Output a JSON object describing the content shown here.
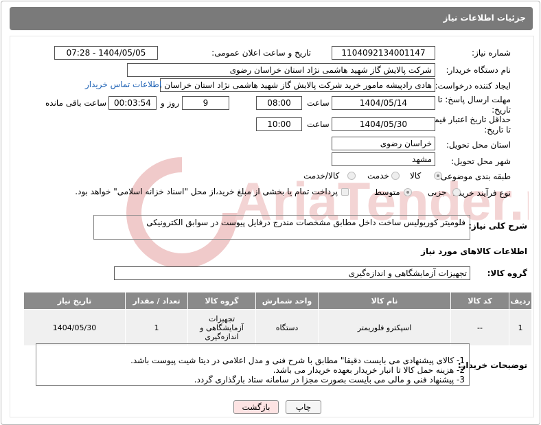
{
  "header": {
    "title": "جزئیات اطلاعات نیاز"
  },
  "form": {
    "need_number_label": "شماره نیاز:",
    "need_number": "1104092134001147",
    "announce_label": "تاریخ و ساعت اعلان عمومی:",
    "announce_value": "1404/05/05 - 07:28",
    "buyer_org_label": "نام دستگاه خریدار:",
    "buyer_org": "شرکت پالایش گاز شهید هاشمی نژاد   استان خراسان رضوی",
    "creator_label": "ایجاد کننده درخواست:",
    "creator": "هادی رادپیشه مامور خرید شرکت پالایش گاز شهید هاشمی نژاد   استان خراسان رضوی",
    "contact_link": "اطلاعات تماس خریدار",
    "deadline_label_1": "مهلت ارسال پاسخ: تا",
    "deadline_label_2": "تاریخ:",
    "deadline_date": "1404/05/14",
    "time_label": "ساعت",
    "deadline_time": "08:00",
    "days_count": "9",
    "days_label": "روز و",
    "remaining_time": "00:03:54",
    "remaining_label": "ساعت باقی مانده",
    "validity_label_1": "حداقل تاریخ اعتبار قیمت:",
    "validity_label_2": "تا تاریخ:",
    "validity_date": "1404/05/30",
    "validity_time": "10:00",
    "province_label": "استان محل تحویل:",
    "province": "خراسان رضوی",
    "city_label": "شهر محل تحویل:",
    "city": "مشهد",
    "category_label": "طبقه بندی موضوعی:",
    "category_options": [
      "کالا",
      "خدمت",
      "کالا/خدمت"
    ],
    "process_label": "نوع فرآیند خرید :",
    "process_options": [
      "جزیی",
      "متوسط"
    ],
    "payment_note": "پرداخت تمام یا بخشی از مبلغ خرید،از محل \"اسناد خزانه اسلامی\" خواهد بود.",
    "description_label": "شرح کلی نیاز:",
    "description": "فلومیتر کوریولیس ساخت داخل مطابق مشخصات مندرج درفایل پیوست در سوابق الکترونیکی",
    "goods_info_title": "اطلاعات کالاهای مورد نیاز",
    "goods_group_label": "گروه کالا:",
    "goods_group": "تجهیزات آزمایشگاهی و اندازه‌گیری",
    "buyer_notes_label": "توضیحات خریدار:",
    "buyer_notes": "1-    کالای پیشنهادی می بایست دقیقا\" مطابق با شرح فنی و مدل اعلامی در دیتا شیت پیوست باشد.\n2-    هزینه حمل کالا تا انبار خریدار بعهده خریدار می باشد.\n3-    پیشنهاد فنی و مالی می بایست بصورت مجزا در سامانه ستاد بارگذاری گردد."
  },
  "table": {
    "headers": [
      "ردیف",
      "کد کالا",
      "نام کالا",
      "واحد شمارش",
      "گروه کالا",
      "تعداد / مقدار",
      "تاریخ نیاز"
    ],
    "rows": [
      [
        "1",
        "--",
        "اسپکترو فلوریمتر",
        "دستگاه",
        "تجهیزات آزمایشگاهی و اندازه‌گیری",
        "1",
        "1404/05/30"
      ]
    ]
  },
  "buttons": {
    "print": "چاپ",
    "back": "بازگشت"
  },
  "colors": {
    "header_bg": "#7a7a7a",
    "table_header_bg": "#8a8a8a",
    "link": "#1a5fb4",
    "back_btn_bg": "#fde3e3"
  }
}
